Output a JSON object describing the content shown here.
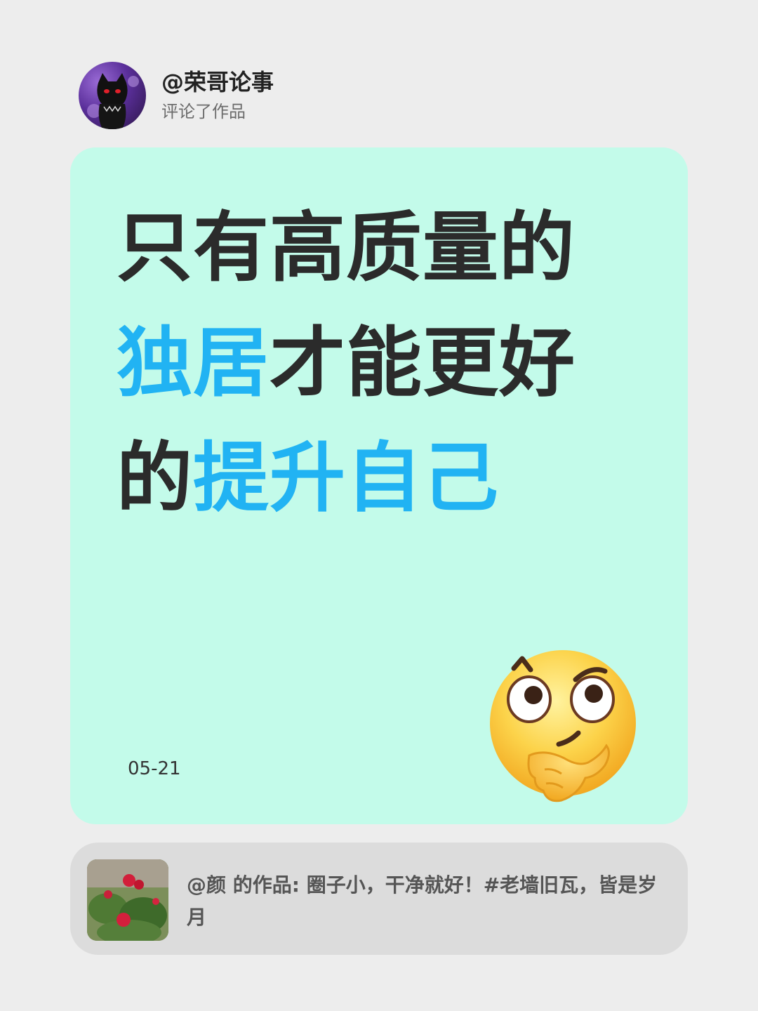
{
  "header": {
    "username": "@荣哥论事",
    "action": "评论了作品",
    "avatar_icon": "black-cat-avatar-icon"
  },
  "card": {
    "background": "#c3fbea",
    "highlight_color": "#21b3f3",
    "line1": {
      "text": "只有高质量的"
    },
    "line2": {
      "hl": "独居",
      "rest": "才能更好"
    },
    "line3": {
      "pre": "的",
      "hl": "提升自己"
    },
    "date": "05-21",
    "emoji_icon": "thinking-face-emoji-icon"
  },
  "quote": {
    "text": "@颜 的作品: 圈子小，干净就好！#老墙旧瓦，皆是岁月",
    "thumbnail_icon": "red-roses-thumbnail-icon"
  }
}
